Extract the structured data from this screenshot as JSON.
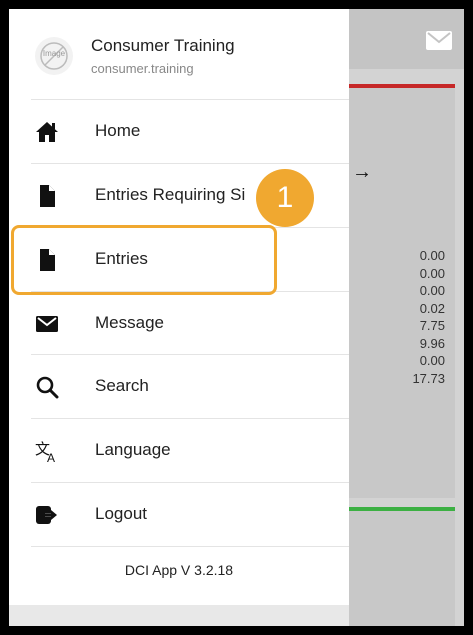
{
  "profile": {
    "avatar_text": "Image",
    "name": "Consumer Training",
    "username": "consumer.training"
  },
  "menu": [
    {
      "label": "Home",
      "icon": "home-icon"
    },
    {
      "label": "Entries Requiring Si",
      "icon": "document-icon"
    },
    {
      "label": "Entries",
      "icon": "document-icon"
    },
    {
      "label": "Message",
      "icon": "envelope-icon"
    },
    {
      "label": "Search",
      "icon": "search-icon"
    },
    {
      "label": "Language",
      "icon": "translate-icon"
    },
    {
      "label": "Logout",
      "icon": "logout-icon"
    }
  ],
  "version": "DCI App V 3.2.18",
  "annotation": {
    "step_number": "1",
    "color": "#f0a830"
  },
  "background": {
    "arrow": "→",
    "values": [
      "0.00",
      "0.00",
      "0.00",
      "0.02",
      "7.75",
      "9.96",
      "0.00",
      "17.73"
    ],
    "card1_accent": "#c62828",
    "card2_accent": "#3cb043"
  }
}
